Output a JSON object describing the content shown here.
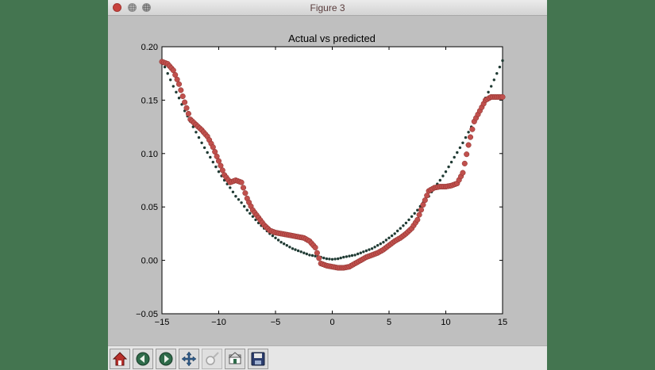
{
  "window": {
    "title": "Figure 3"
  },
  "toolbar": {
    "tools": [
      "home-icon",
      "back-icon",
      "forward-icon",
      "pan-icon",
      "zoom-icon",
      "subplots-icon",
      "save-icon"
    ]
  },
  "colors": {
    "actual": "#c0504d",
    "predicted": "#1f3a33",
    "background": "#447550"
  },
  "chart_data": {
    "type": "scatter",
    "title": "Actual vs predicted",
    "xlabel": "",
    "ylabel": "",
    "xlim": [
      -15,
      15
    ],
    "ylim": [
      -0.05,
      0.2
    ],
    "xticks": [
      "−15",
      "−10",
      "−5",
      "0",
      "5",
      "10",
      "15"
    ],
    "yticks": [
      "−0.05",
      "0.00",
      "0.05",
      "0.10",
      "0.15",
      "0.20"
    ],
    "grid": false,
    "legend": "none",
    "series": [
      {
        "role": "actual",
        "x": [
          -15,
          -14.5,
          -14,
          -13.5,
          -13,
          -12.5,
          -12,
          -11.5,
          -11,
          -10.5,
          -10,
          -9.5,
          -9,
          -8.5,
          -8,
          -7.5,
          -7,
          -6.5,
          -6,
          -5.5,
          -5,
          -4.5,
          -4,
          -3.5,
          -3,
          -2.5,
          -2,
          -1.5,
          -1,
          -0.5,
          0,
          0.5,
          1,
          1.5,
          2,
          2.5,
          3,
          3.5,
          4,
          4.5,
          5,
          5.5,
          6,
          6.5,
          7,
          7.5,
          8,
          8.5,
          9,
          9.5,
          10,
          10.5,
          11,
          11.5,
          12,
          12.5,
          13,
          13.5,
          14,
          14.5,
          15
        ],
        "y": [
          0.186,
          0.184,
          0.178,
          0.165,
          0.148,
          0.132,
          0.127,
          0.122,
          0.116,
          0.106,
          0.093,
          0.08,
          0.073,
          0.075,
          0.073,
          0.058,
          0.047,
          0.04,
          0.033,
          0.028,
          0.026,
          0.025,
          0.024,
          0.023,
          0.022,
          0.021,
          0.018,
          0.012,
          -0.003,
          -0.005,
          -0.006,
          -0.007,
          -0.007,
          -0.006,
          -0.003,
          0.0,
          0.003,
          0.005,
          0.007,
          0.01,
          0.014,
          0.018,
          0.021,
          0.025,
          0.03,
          0.038,
          0.052,
          0.065,
          0.068,
          0.069,
          0.069,
          0.07,
          0.072,
          0.082,
          0.108,
          0.13,
          0.14,
          0.15,
          0.153,
          0.153,
          0.153
        ]
      },
      {
        "role": "predicted",
        "x": [
          -15,
          -14.5,
          -14,
          -13.5,
          -13,
          -12.5,
          -12,
          -11.5,
          -11,
          -10.5,
          -10,
          -9.5,
          -9,
          -8.5,
          -8,
          -7.5,
          -7,
          -6.5,
          -6,
          -5.5,
          -5,
          -4.5,
          -4,
          -3.5,
          -3,
          -2.5,
          -2,
          -1.5,
          -1,
          -0.5,
          0,
          0.5,
          1,
          1.5,
          2,
          2.5,
          3,
          3.5,
          4,
          4.5,
          5,
          5.5,
          6,
          6.5,
          7,
          7.5,
          8,
          8.5,
          9,
          9.5,
          10,
          10.5,
          11,
          11.5,
          12,
          12.5,
          13,
          13.5,
          14,
          14.5,
          15
        ],
        "y": [
          0.187,
          0.175,
          0.163,
          0.152,
          0.14,
          0.13,
          0.12,
          0.11,
          0.101,
          0.092,
          0.083,
          0.075,
          0.068,
          0.06,
          0.054,
          0.047,
          0.041,
          0.035,
          0.03,
          0.025,
          0.021,
          0.017,
          0.014,
          0.011,
          0.009,
          0.007,
          0.005,
          0.004,
          0.003,
          0.0015,
          0.001,
          0.0015,
          0.003,
          0.004,
          0.005,
          0.007,
          0.009,
          0.011,
          0.014,
          0.017,
          0.021,
          0.025,
          0.03,
          0.035,
          0.041,
          0.047,
          0.054,
          0.06,
          0.068,
          0.075,
          0.083,
          0.092,
          0.101,
          0.11,
          0.12,
          0.13,
          0.14,
          0.152,
          0.163,
          0.175,
          0.187
        ]
      }
    ]
  }
}
